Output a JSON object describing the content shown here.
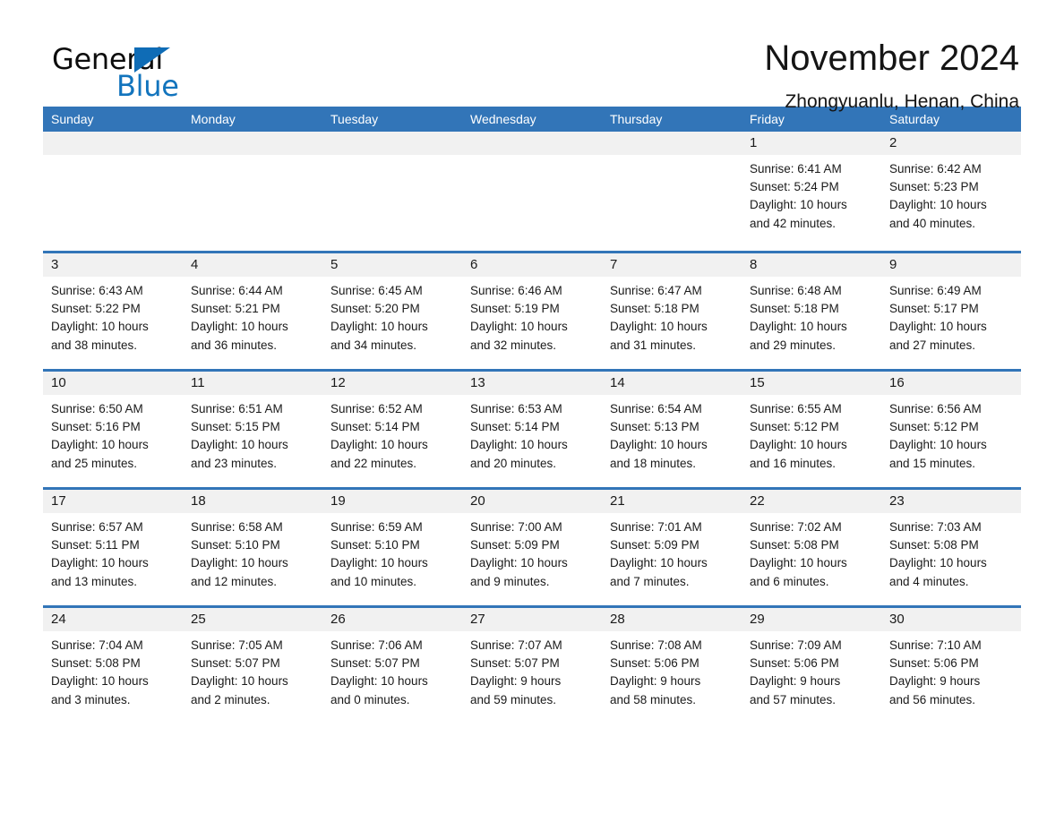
{
  "brand": {
    "name_part1": "General",
    "name_part2": "Blue",
    "accent_color": "#1274bd",
    "header_color": "#3275b8"
  },
  "header": {
    "title": "November 2024",
    "subtitle": "Zhongyuanlu, Henan, China"
  },
  "calendar": {
    "weekdays": [
      "Sunday",
      "Monday",
      "Tuesday",
      "Wednesday",
      "Thursday",
      "Friday",
      "Saturday"
    ],
    "weeks": [
      [
        {
          "day": ""
        },
        {
          "day": ""
        },
        {
          "day": ""
        },
        {
          "day": ""
        },
        {
          "day": ""
        },
        {
          "day": "1",
          "sunrise": "Sunrise: 6:41 AM",
          "sunset": "Sunset: 5:24 PM",
          "daylight1": "Daylight: 10 hours",
          "daylight2": "and 42 minutes."
        },
        {
          "day": "2",
          "sunrise": "Sunrise: 6:42 AM",
          "sunset": "Sunset: 5:23 PM",
          "daylight1": "Daylight: 10 hours",
          "daylight2": "and 40 minutes."
        }
      ],
      [
        {
          "day": "3",
          "sunrise": "Sunrise: 6:43 AM",
          "sunset": "Sunset: 5:22 PM",
          "daylight1": "Daylight: 10 hours",
          "daylight2": "and 38 minutes."
        },
        {
          "day": "4",
          "sunrise": "Sunrise: 6:44 AM",
          "sunset": "Sunset: 5:21 PM",
          "daylight1": "Daylight: 10 hours",
          "daylight2": "and 36 minutes."
        },
        {
          "day": "5",
          "sunrise": "Sunrise: 6:45 AM",
          "sunset": "Sunset: 5:20 PM",
          "daylight1": "Daylight: 10 hours",
          "daylight2": "and 34 minutes."
        },
        {
          "day": "6",
          "sunrise": "Sunrise: 6:46 AM",
          "sunset": "Sunset: 5:19 PM",
          "daylight1": "Daylight: 10 hours",
          "daylight2": "and 32 minutes."
        },
        {
          "day": "7",
          "sunrise": "Sunrise: 6:47 AM",
          "sunset": "Sunset: 5:18 PM",
          "daylight1": "Daylight: 10 hours",
          "daylight2": "and 31 minutes."
        },
        {
          "day": "8",
          "sunrise": "Sunrise: 6:48 AM",
          "sunset": "Sunset: 5:18 PM",
          "daylight1": "Daylight: 10 hours",
          "daylight2": "and 29 minutes."
        },
        {
          "day": "9",
          "sunrise": "Sunrise: 6:49 AM",
          "sunset": "Sunset: 5:17 PM",
          "daylight1": "Daylight: 10 hours",
          "daylight2": "and 27 minutes."
        }
      ],
      [
        {
          "day": "10",
          "sunrise": "Sunrise: 6:50 AM",
          "sunset": "Sunset: 5:16 PM",
          "daylight1": "Daylight: 10 hours",
          "daylight2": "and 25 minutes."
        },
        {
          "day": "11",
          "sunrise": "Sunrise: 6:51 AM",
          "sunset": "Sunset: 5:15 PM",
          "daylight1": "Daylight: 10 hours",
          "daylight2": "and 23 minutes."
        },
        {
          "day": "12",
          "sunrise": "Sunrise: 6:52 AM",
          "sunset": "Sunset: 5:14 PM",
          "daylight1": "Daylight: 10 hours",
          "daylight2": "and 22 minutes."
        },
        {
          "day": "13",
          "sunrise": "Sunrise: 6:53 AM",
          "sunset": "Sunset: 5:14 PM",
          "daylight1": "Daylight: 10 hours",
          "daylight2": "and 20 minutes."
        },
        {
          "day": "14",
          "sunrise": "Sunrise: 6:54 AM",
          "sunset": "Sunset: 5:13 PM",
          "daylight1": "Daylight: 10 hours",
          "daylight2": "and 18 minutes."
        },
        {
          "day": "15",
          "sunrise": "Sunrise: 6:55 AM",
          "sunset": "Sunset: 5:12 PM",
          "daylight1": "Daylight: 10 hours",
          "daylight2": "and 16 minutes."
        },
        {
          "day": "16",
          "sunrise": "Sunrise: 6:56 AM",
          "sunset": "Sunset: 5:12 PM",
          "daylight1": "Daylight: 10 hours",
          "daylight2": "and 15 minutes."
        }
      ],
      [
        {
          "day": "17",
          "sunrise": "Sunrise: 6:57 AM",
          "sunset": "Sunset: 5:11 PM",
          "daylight1": "Daylight: 10 hours",
          "daylight2": "and 13 minutes."
        },
        {
          "day": "18",
          "sunrise": "Sunrise: 6:58 AM",
          "sunset": "Sunset: 5:10 PM",
          "daylight1": "Daylight: 10 hours",
          "daylight2": "and 12 minutes."
        },
        {
          "day": "19",
          "sunrise": "Sunrise: 6:59 AM",
          "sunset": "Sunset: 5:10 PM",
          "daylight1": "Daylight: 10 hours",
          "daylight2": "and 10 minutes."
        },
        {
          "day": "20",
          "sunrise": "Sunrise: 7:00 AM",
          "sunset": "Sunset: 5:09 PM",
          "daylight1": "Daylight: 10 hours",
          "daylight2": "and 9 minutes."
        },
        {
          "day": "21",
          "sunrise": "Sunrise: 7:01 AM",
          "sunset": "Sunset: 5:09 PM",
          "daylight1": "Daylight: 10 hours",
          "daylight2": "and 7 minutes."
        },
        {
          "day": "22",
          "sunrise": "Sunrise: 7:02 AM",
          "sunset": "Sunset: 5:08 PM",
          "daylight1": "Daylight: 10 hours",
          "daylight2": "and 6 minutes."
        },
        {
          "day": "23",
          "sunrise": "Sunrise: 7:03 AM",
          "sunset": "Sunset: 5:08 PM",
          "daylight1": "Daylight: 10 hours",
          "daylight2": "and 4 minutes."
        }
      ],
      [
        {
          "day": "24",
          "sunrise": "Sunrise: 7:04 AM",
          "sunset": "Sunset: 5:08 PM",
          "daylight1": "Daylight: 10 hours",
          "daylight2": "and 3 minutes."
        },
        {
          "day": "25",
          "sunrise": "Sunrise: 7:05 AM",
          "sunset": "Sunset: 5:07 PM",
          "daylight1": "Daylight: 10 hours",
          "daylight2": "and 2 minutes."
        },
        {
          "day": "26",
          "sunrise": "Sunrise: 7:06 AM",
          "sunset": "Sunset: 5:07 PM",
          "daylight1": "Daylight: 10 hours",
          "daylight2": "and 0 minutes."
        },
        {
          "day": "27",
          "sunrise": "Sunrise: 7:07 AM",
          "sunset": "Sunset: 5:07 PM",
          "daylight1": "Daylight: 9 hours",
          "daylight2": "and 59 minutes."
        },
        {
          "day": "28",
          "sunrise": "Sunrise: 7:08 AM",
          "sunset": "Sunset: 5:06 PM",
          "daylight1": "Daylight: 9 hours",
          "daylight2": "and 58 minutes."
        },
        {
          "day": "29",
          "sunrise": "Sunrise: 7:09 AM",
          "sunset": "Sunset: 5:06 PM",
          "daylight1": "Daylight: 9 hours",
          "daylight2": "and 57 minutes."
        },
        {
          "day": "30",
          "sunrise": "Sunrise: 7:10 AM",
          "sunset": "Sunset: 5:06 PM",
          "daylight1": "Daylight: 9 hours",
          "daylight2": "and 56 minutes."
        }
      ]
    ]
  }
}
